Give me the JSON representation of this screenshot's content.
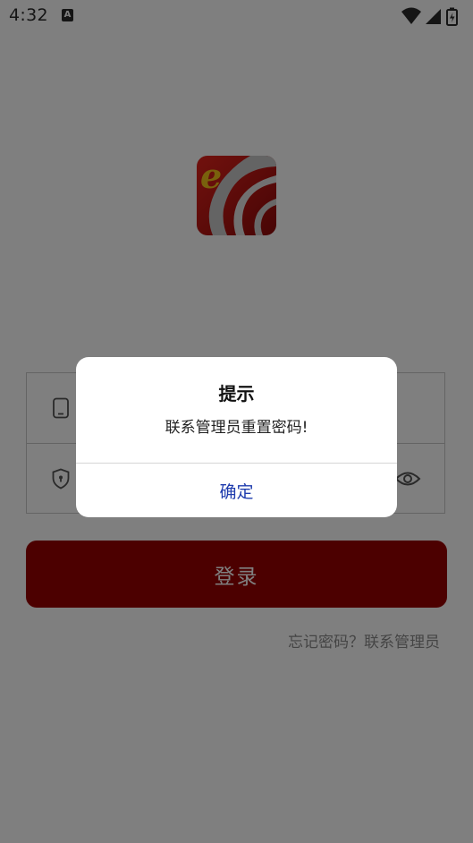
{
  "status_bar": {
    "time": "4:32",
    "notification_glyph": "A",
    "icons": [
      "wifi-icon",
      "cellular-signal-icon",
      "battery-icon"
    ]
  },
  "app": {
    "logo_letter": "e",
    "brand_color": "#980000"
  },
  "login_form": {
    "phone_field": {
      "icon": "phone-icon",
      "placeholder": "",
      "value": ""
    },
    "password_field": {
      "icon": "shield-lock-icon",
      "placeholder": "",
      "value": "",
      "toggle_icon": "eye-icon"
    },
    "submit_label": "登录",
    "forgot_text": "忘记密码？联系管理员"
  },
  "dialog": {
    "title": "提示",
    "message": "联系管理员重置密码!",
    "confirm_label": "确定",
    "confirm_color": "#1f3cae"
  }
}
